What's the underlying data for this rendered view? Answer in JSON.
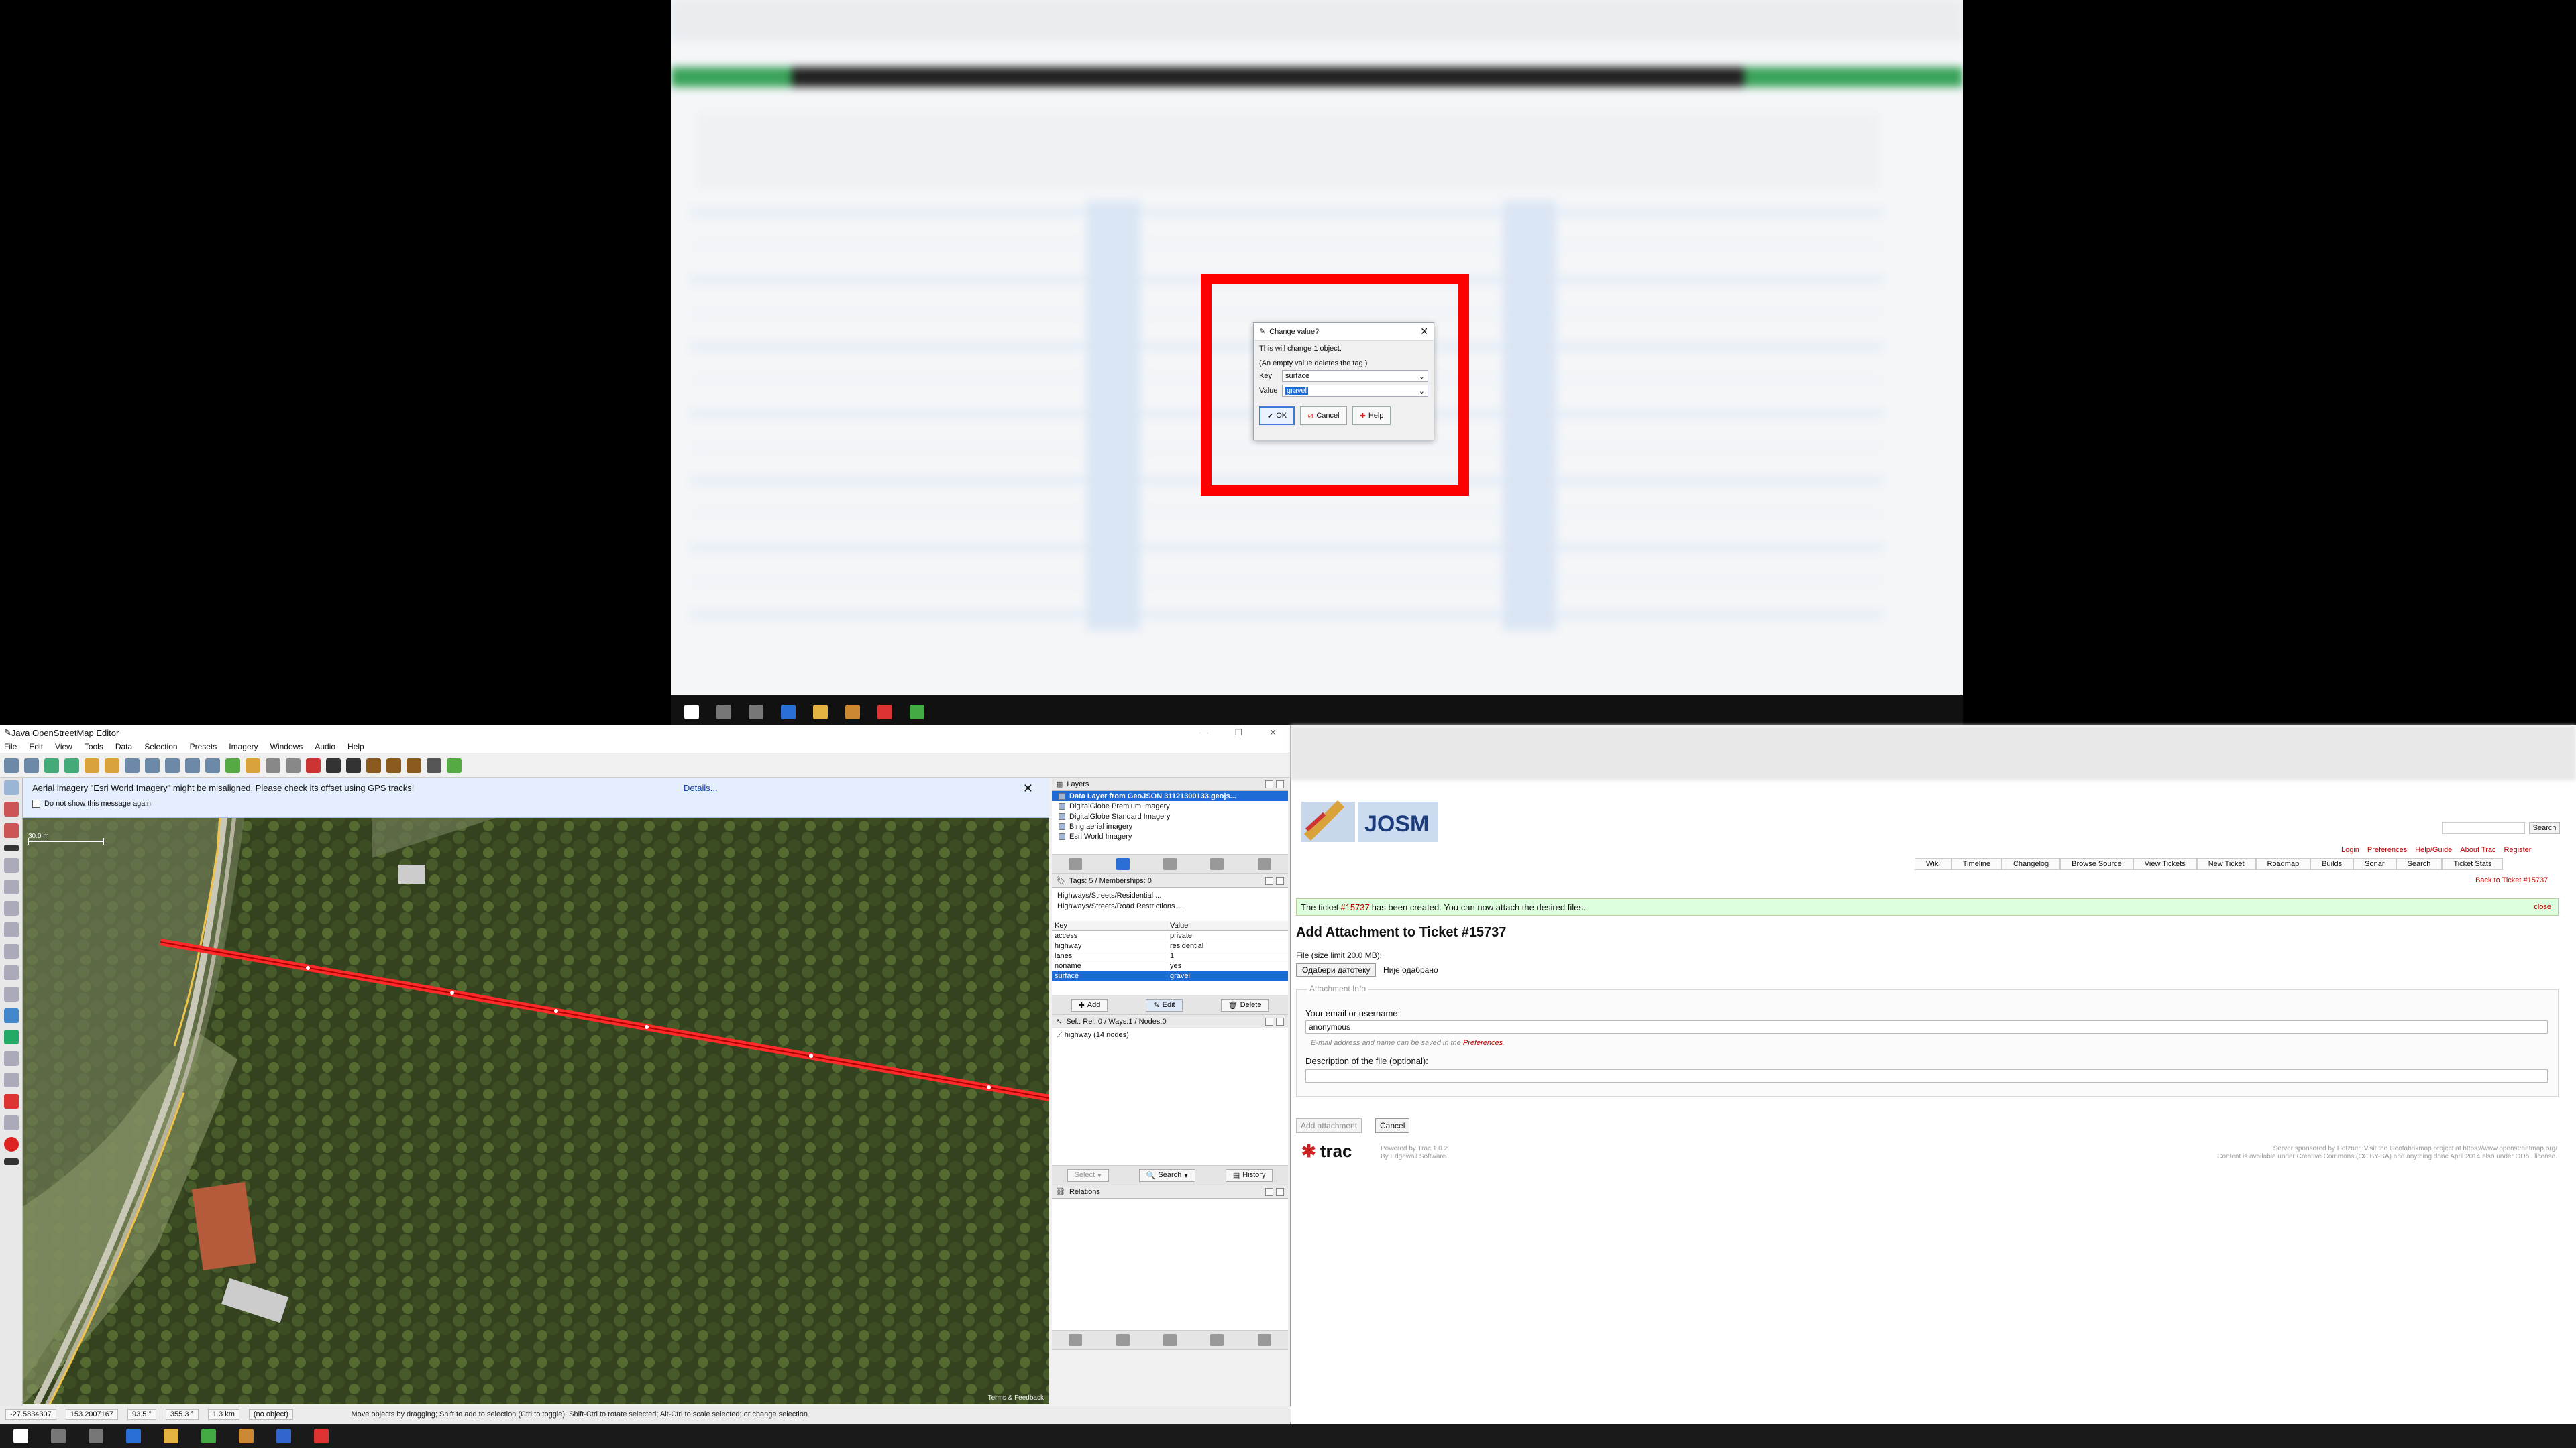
{
  "dialog": {
    "title": "Change value?",
    "message": "This will change 1 object.",
    "hint": "(An empty value deletes the tag.)",
    "key_label": "Key",
    "key_value": "surface",
    "value_label": "Value",
    "value_value": "gravel",
    "ok": "OK",
    "cancel": "Cancel",
    "help": "Help"
  },
  "josm": {
    "title": "Java OpenStreetMap Editor",
    "menu": [
      "File",
      "Edit",
      "View",
      "Tools",
      "Data",
      "Selection",
      "Presets",
      "Imagery",
      "Windows",
      "Audio",
      "Help"
    ],
    "notice": {
      "text": "Aerial imagery \"Esri World Imagery\" might be misaligned. Please check its offset using GPS tracks!",
      "details": "Details...",
      "dont_show": "Do not show this message again"
    },
    "scale_label": "30.0 m",
    "attribution": "Terms & Feedback",
    "layers": {
      "header": "Layers",
      "items": [
        "Data Layer from GeoJSON 31121300133.geojs...",
        "DigitalGlobe Premium Imagery",
        "DigitalGlobe Standard Imagery",
        "Bing aerial imagery",
        "Esri World Imagery"
      ]
    },
    "tags": {
      "header": "Tags: 5 / Memberships: 0",
      "presets": [
        "Highways/Streets/Residential ...",
        "Highways/Streets/Road Restrictions ..."
      ],
      "col_key": "Key",
      "col_value": "Value",
      "rows": [
        {
          "k": "access",
          "v": "private"
        },
        {
          "k": "highway",
          "v": "residential"
        },
        {
          "k": "lanes",
          "v": "1"
        },
        {
          "k": "noname",
          "v": "yes"
        },
        {
          "k": "surface",
          "v": "gravel"
        }
      ],
      "add": "Add",
      "edit": "Edit",
      "delete": "Delete"
    },
    "selection": {
      "header": "Sel.: Rel.:0 / Ways:1 / Nodes:0",
      "item": "highway (14 nodes)",
      "select": "Select",
      "search": "Search",
      "history": "History"
    },
    "relations": {
      "header": "Relations"
    },
    "status": {
      "lat": "-27.5834307",
      "lon": "153.2007167",
      "heading": "93.5 °",
      "angle": "355.3 °",
      "length": "1.3 km",
      "name": "(no object)",
      "message": "Move objects by dragging; Shift to add to selection (Ctrl to toggle); Shift-Ctrl to rotate selected; Alt-Ctrl to scale selected; or change selection"
    }
  },
  "trac": {
    "search_btn": "Search",
    "meta_nav": [
      "Login",
      "Preferences",
      "Help/Guide",
      "About Trac",
      "Register"
    ],
    "main_nav": [
      "Wiki",
      "Timeline",
      "Changelog",
      "Browse Source",
      "View Tickets",
      "New Ticket",
      "Roadmap",
      "Builds",
      "Sonar",
      "Search",
      "Ticket Stats"
    ],
    "back": "Back to Ticket #15737",
    "notice_pre": "The ticket ",
    "notice_link": "#15737",
    "notice_post": " has been created. You can now attach the desired files.",
    "notice_close": "close",
    "heading": "Add Attachment to Ticket #15737",
    "file_label": "File (size limit 20.0 MB):",
    "file_button": "Одабери датотеку",
    "file_none": "Није одабрано",
    "legend": "Attachment Info",
    "email_label": "Your email or username:",
    "email_value": "anonymous",
    "email_hint": "E-mail address and name can be saved in the ",
    "email_hint_link": "Preferences",
    "desc_label": "Description of the file (optional):",
    "add_button": "Add attachment",
    "cancel_button": "Cancel",
    "logo": "trac",
    "powered1": "Powered by Trac 1.0.2",
    "powered2": "By Edgewall Software.",
    "footer1": "Server sponsored by Hetzner. Visit the Geofabrikmap project at https://www.openstreetmap.org/",
    "footer2": "Content is available under Creative Commons (CC BY-SA) and anything done April 2014 also under ODbL license."
  }
}
